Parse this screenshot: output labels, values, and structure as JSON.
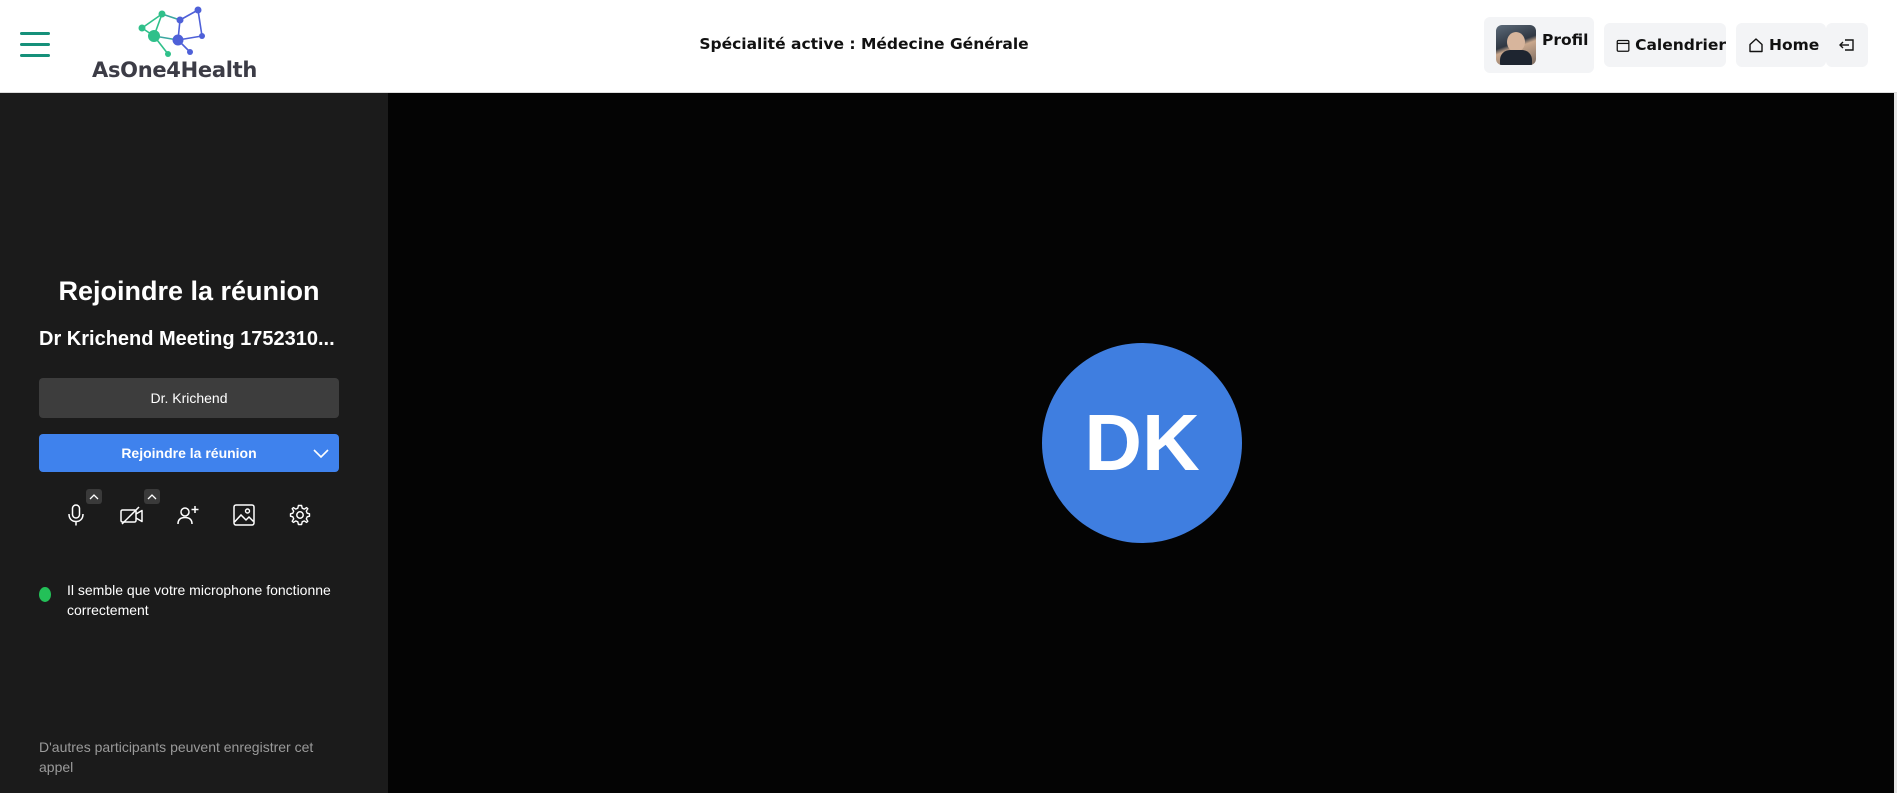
{
  "header": {
    "logo_text": "AsOne4Health",
    "specialty": "Spécialité active : Médecine Générale",
    "nav": {
      "profile_label": "Profil",
      "calendar_label": "Calendrier",
      "home_label": "Home"
    },
    "icons": [
      "hamburger-menu-icon",
      "calendar-icon",
      "home-icon",
      "logout-icon"
    ],
    "colors": {
      "menu_accent": "#16907a",
      "logo_green": "#2fc08a",
      "logo_blue": "#4e60d8"
    }
  },
  "prejoin": {
    "title": "Rejoindre la réunion",
    "meeting_name": "Dr Krichend Meeting 1752310...",
    "display_name_value": "Dr. Krichend",
    "join_button_label": "Rejoindre la réunion",
    "toolbar_icons": [
      "microphone-icon",
      "camera-off-icon",
      "invite-person-icon",
      "background-image-icon",
      "settings-gear-icon"
    ],
    "mic_status_text": "Il semble que votre microphone fonctionne correctement",
    "recording_notice": "D'autres participants peuvent enregistrer cet appel",
    "colors": {
      "panel_bg": "#1b1b1b",
      "join_button": "#3f82ed",
      "mic_ok_dot": "#23c058"
    }
  },
  "stage": {
    "avatar_initials": "DK",
    "colors": {
      "background": "#040404",
      "avatar_circle": "#3f7ee0"
    }
  }
}
